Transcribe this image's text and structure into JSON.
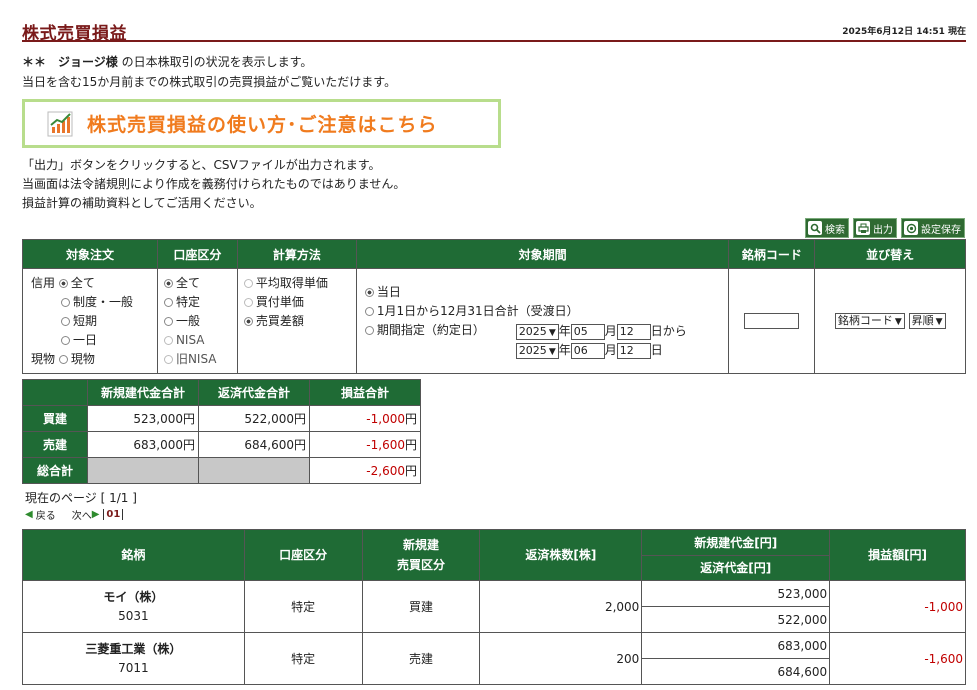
{
  "header": {
    "title": "株式売買損益",
    "timestamp": "2025年6月12日 14:51 現在"
  },
  "intro": {
    "prefix": "＊＊　",
    "user_name": "ジョージ様",
    "line1_suffix": " の日本株取引の状況を表示します。",
    "line2": "当日を含む15か月前までの株式取引の売買損益がご覧いただけます。"
  },
  "banner": {
    "text": "株式売買損益の使い方･ご注意はこちら",
    "icon": "chart-icon"
  },
  "notes": [
    "「出力」ボタンをクリックすると、CSVファイルが出力されます。",
    "当画面は法令諸規則により作成を義務付けられたものではありません。",
    "損益計算の補助資料としてご活用ください。"
  ],
  "toolbar": {
    "search": "検索",
    "output": "出力",
    "save": "設定保存"
  },
  "conditions": {
    "headers": [
      "対象注文",
      "口座区分",
      "計算方法",
      "対象期間",
      "銘柄コード",
      "並び替え"
    ],
    "order_prefix_credit": "信用",
    "order_prefix_spot": "現物",
    "order_options": [
      {
        "label": "全て",
        "selected": true
      },
      {
        "label": "制度・一般",
        "selected": false
      },
      {
        "label": "短期",
        "selected": false
      },
      {
        "label": "一日",
        "selected": false
      },
      {
        "label": "現物",
        "selected": false
      }
    ],
    "account_options": [
      {
        "label": "全て",
        "selected": true,
        "disabled": false
      },
      {
        "label": "特定",
        "selected": false,
        "disabled": false
      },
      {
        "label": "一般",
        "selected": false,
        "disabled": false
      },
      {
        "label": "NISA",
        "selected": false,
        "disabled": true
      },
      {
        "label": "旧NISA",
        "selected": false,
        "disabled": true
      }
    ],
    "calc_options": [
      {
        "label": "平均取得単価",
        "selected": false
      },
      {
        "label": "買付単価",
        "selected": false
      },
      {
        "label": "売買差額",
        "selected": true
      }
    ],
    "period_options": [
      {
        "label": "当日",
        "selected": true
      },
      {
        "label": "1月1日から12月31日合計（受渡日）",
        "selected": false
      },
      {
        "label": "期間指定（約定日）",
        "selected": false
      }
    ],
    "period_from": {
      "year": "2025",
      "month": "05",
      "day": "12",
      "suffix": "日から"
    },
    "period_to": {
      "year": "2025",
      "month": "06",
      "day": "12",
      "suffix": "日"
    },
    "unit_year": "年",
    "unit_month": "月",
    "code_value": "",
    "sort_field": "銘柄コード",
    "sort_order": "昇順"
  },
  "summary": {
    "headers": [
      "新規建代金合計",
      "返済代金合計",
      "損益合計"
    ],
    "rows": [
      {
        "label": "買建",
        "new_total": "523,000",
        "repay_total": "522,000",
        "pl": "-1,000"
      },
      {
        "label": "売建",
        "new_total": "683,000",
        "repay_total": "684,600",
        "pl": "-1,600"
      },
      {
        "label": "総合計",
        "new_total": "",
        "repay_total": "",
        "pl": "-2,600"
      }
    ],
    "yen": "円"
  },
  "pager": {
    "info": "現在のページ [ 1/1 ]",
    "prev": "戻る",
    "next": "次へ",
    "page": "01"
  },
  "details": {
    "headers": {
      "name": "銘柄",
      "account": "口座区分",
      "type_line1": "新規建",
      "type_line2": "売買区分",
      "qty": "返済株数[株]",
      "new_amt": "新規建代金[円]",
      "repay_amt": "返済代金[円]",
      "pl": "損益額[円]"
    },
    "rows": [
      {
        "name": "モイ（株）",
        "code": "5031",
        "account": "特定",
        "type": "買建",
        "qty": "2,000",
        "new_amt": "523,000",
        "repay_amt": "522,000",
        "pl": "-1,000"
      },
      {
        "name": "三菱重工業（株）",
        "code": "7011",
        "account": "特定",
        "type": "売建",
        "qty": "200",
        "new_amt": "683,000",
        "repay_amt": "684,600",
        "pl": "-1,600"
      }
    ]
  }
}
